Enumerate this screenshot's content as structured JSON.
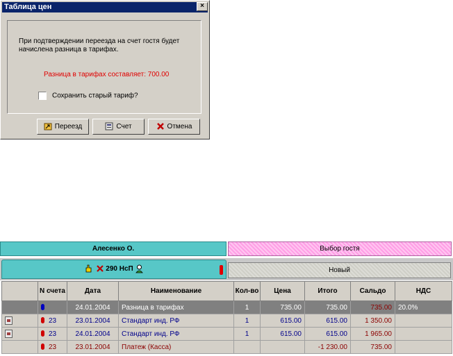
{
  "dialog": {
    "title": "Таблица цен",
    "close": "×",
    "message": "При подтверждении переезда на счет гостя будет начислена разница в тарифах.",
    "difference": "Разница в тарифах составляет:  700.00",
    "checkbox_label": "Сохранить старый тариф?",
    "buttons": {
      "move": "Переезд",
      "account": "Счет",
      "cancel": "Отмена"
    }
  },
  "tabs": {
    "guest": "Алесенко О.",
    "choose_guest": "Выбор гостя",
    "room": "290 НсП",
    "new": "Новый"
  },
  "table": {
    "headers": [
      "",
      "N счета",
      "Дата",
      "Наименование",
      "Кол-во",
      "Цена",
      "Итого",
      "Сальдо",
      "НДС"
    ],
    "rows": [
      {
        "account": "",
        "date": "24.01.2004",
        "name": "Разница в тарифах",
        "qty": "1",
        "price": "735.00",
        "total": "735.00",
        "balance": "735.00",
        "vat": "20.0%"
      },
      {
        "account": "23",
        "date": "23.01.2004",
        "name": "Стандарт инд. РФ",
        "qty": "1",
        "price": "615.00",
        "total": "615.00",
        "balance": "1 350.00",
        "vat": ""
      },
      {
        "account": "23",
        "date": "24.01.2004",
        "name": "Стандарт инд. РФ",
        "qty": "1",
        "price": "615.00",
        "total": "615.00",
        "balance": "1 965.00",
        "vat": ""
      },
      {
        "account": "23",
        "date": "23.01.2004",
        "name": "Платеж (Касса)",
        "qty": "",
        "price": "",
        "total": "-1 230.00",
        "balance": "735.00",
        "vat": ""
      }
    ]
  },
  "colors": {
    "title_bar": "#0a246a",
    "tab_active": "#57c7c7",
    "tab_pink": "#ff9ee6",
    "difference_text": "#e00000"
  }
}
